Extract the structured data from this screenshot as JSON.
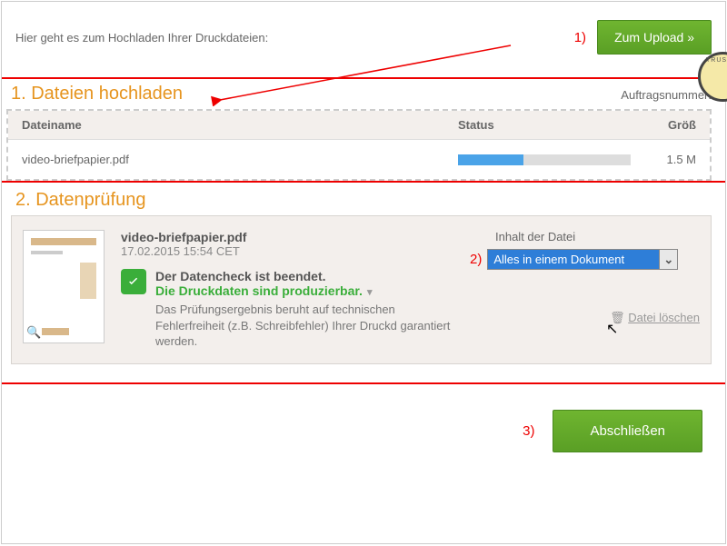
{
  "top": {
    "text": "Hier geht es zum Hochladen Ihrer Druckdateien:",
    "upload_btn": "Zum Upload »"
  },
  "ann": {
    "a1": "1)",
    "a2": "2)",
    "a3": "3)"
  },
  "section1": {
    "title": "1. Dateien hochladen",
    "ordernum_label": "Auftragsnummer:",
    "headers": {
      "name": "Dateiname",
      "status": "Status",
      "size": "Größ"
    },
    "file": {
      "name": "video-briefpapier.pdf",
      "progress": 38,
      "size": "1.5 M"
    }
  },
  "section2": {
    "title": "2. Datenprüfung",
    "file": {
      "name": "video-briefpapier.pdf",
      "date": "17.02.2015 15:54 CET",
      "check1": "Der Datencheck ist beendet.",
      "check2": "Die Druckdaten sind produzierbar.",
      "check3": "Das Prüfungsergebnis beruht auf technischen Fehlerfreiheit (z.B. Schreibfehler) Ihrer Druckd garantiert werden."
    },
    "dropdown": {
      "label": "Inhalt der Datei",
      "value": "Alles in einem Dokument"
    },
    "delete_label": "Datei löschen"
  },
  "bottom": {
    "submit_btn": "Abschließen"
  },
  "badge_text": "TRUSTED"
}
